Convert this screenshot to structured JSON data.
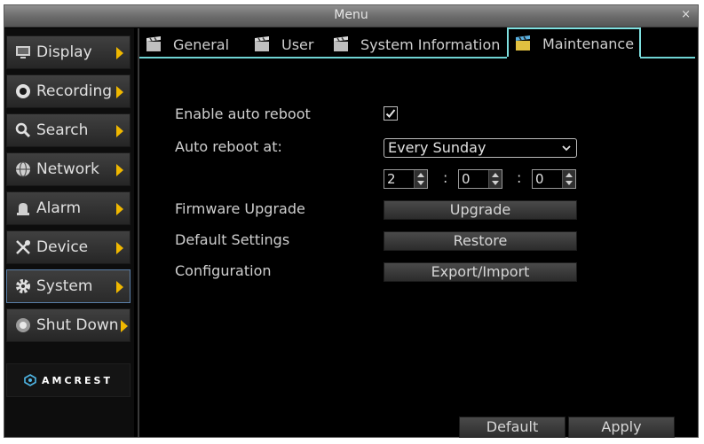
{
  "window": {
    "title": "Menu",
    "close_glyph": "×"
  },
  "sidebar": {
    "items": [
      {
        "label": "Display",
        "icon": "display-icon"
      },
      {
        "label": "Recording",
        "icon": "recording-icon"
      },
      {
        "label": "Search",
        "icon": "search-icon"
      },
      {
        "label": "Network",
        "icon": "network-icon"
      },
      {
        "label": "Alarm",
        "icon": "alarm-icon"
      },
      {
        "label": "Device",
        "icon": "device-icon"
      },
      {
        "label": "System",
        "icon": "gear-icon",
        "active": true
      },
      {
        "label": "Shut Down",
        "icon": "power-icon"
      }
    ],
    "logo": "AMCREST"
  },
  "tabs": [
    {
      "label": "General"
    },
    {
      "label": "User"
    },
    {
      "label": "System Information"
    },
    {
      "label": "Maintenance",
      "active": true
    }
  ],
  "maintenance": {
    "auto_reboot_label": "Enable auto reboot",
    "auto_reboot_checked": true,
    "reboot_at_label": "Auto reboot at:",
    "reboot_day": "Every Sunday",
    "time": {
      "hour": "2",
      "minute": "0",
      "second": "0",
      "separator": ":"
    },
    "firmware_label": "Firmware Upgrade",
    "firmware_button": "Upgrade",
    "default_label": "Default Settings",
    "default_button": "Restore",
    "config_label": "Configuration",
    "config_button": "Export/Import"
  },
  "footer": {
    "default_button": "Default",
    "apply_button": "Apply"
  },
  "colors": {
    "accent_tab": "#7fe0e0",
    "arrow": "#f0b800",
    "active_border": "#5a7fa8"
  }
}
